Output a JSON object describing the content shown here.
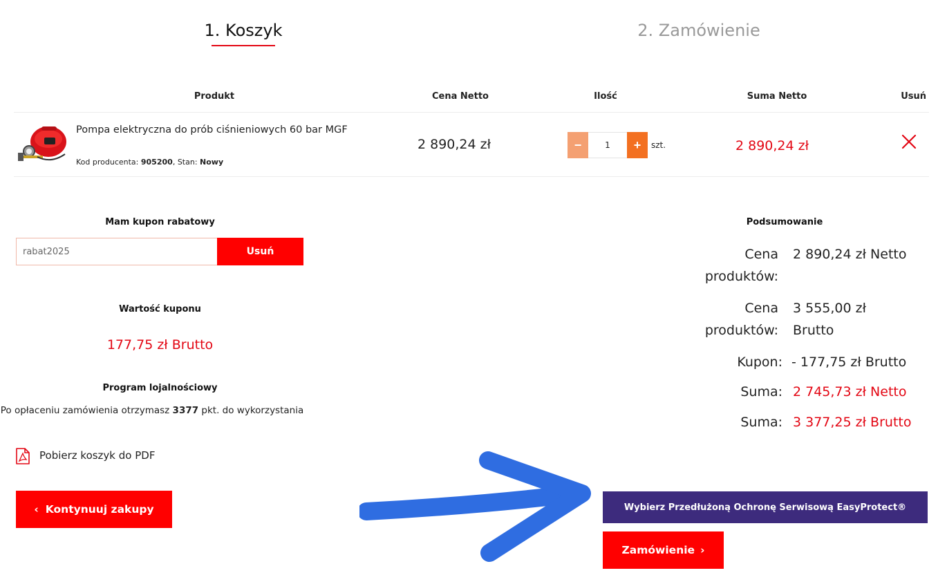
{
  "steps": {
    "step1": "1. Koszyk",
    "step2": "2. Zamówienie"
  },
  "table": {
    "headers": {
      "product": "Produkt",
      "price": "Cena Netto",
      "qty": "Ilość",
      "sum": "Suma Netto",
      "remove": "Usuń"
    },
    "item": {
      "name": "Pompa elektryczna do prób ciśnieniowych 60 bar MGF",
      "code_label": "Kod producenta:",
      "code": "905200",
      "state_label": "Stan:",
      "state": "Nowy",
      "price": "2 890,24 zł",
      "qty_minus": "−",
      "qty_plus": "+",
      "qty": "1",
      "qty_unit": "szt.",
      "sum": "2 890,24 zł"
    }
  },
  "coupon": {
    "title": "Mam kupon rabatowy",
    "value": "rabat2025",
    "remove_button": "Usuń",
    "value_title": "Wartość kuponu",
    "value_amount": "177,75 zł Brutto"
  },
  "loyalty": {
    "title": "Program lojalnościowy",
    "text_before": "Po opłaceniu zamówienia otrzymasz",
    "points": "3377",
    "text_after": "pkt. do wykorzystania"
  },
  "pdf_link": "Pobierz koszyk do PDF",
  "continue_button": "Kontynuuj zakupy",
  "summary": {
    "title": "Podsumowanie",
    "rows": [
      {
        "label_l1": "Cena",
        "label_l2": "produktów:",
        "val_l1": "2 890,24 zł Netto",
        "val_l2": ""
      },
      {
        "label_l1": "Cena",
        "label_l2": "produktów:",
        "val_l1": "3 555,00 zł",
        "val_l2": "Brutto"
      },
      {
        "label": "Kupon:",
        "value": "- 177,75 zł Brutto"
      },
      {
        "label": "Suma:",
        "value": "2 745,73 zł Netto"
      },
      {
        "label": "Suma:",
        "value": "3 377,25 zł Brutto"
      }
    ]
  },
  "easyprotect_button": "Wybierz Przedłużoną Ochronę Serwisową EasyProtect®",
  "order_button": "Zamówienie",
  "colors": {
    "accent_red": "#ff0000",
    "price_red": "#e30613",
    "qty_orange": "#f37021",
    "qty_orange_light": "#f4a072",
    "easyprotect_purple": "#3d2b7d",
    "arrow_blue": "#2f6de1"
  },
  "icons": {
    "remove": "close-icon",
    "pdf": "pdf-file-icon",
    "continue": "chevron-left-icon",
    "order": "chevron-right-icon",
    "arrow": "arrow-right-annotation"
  }
}
